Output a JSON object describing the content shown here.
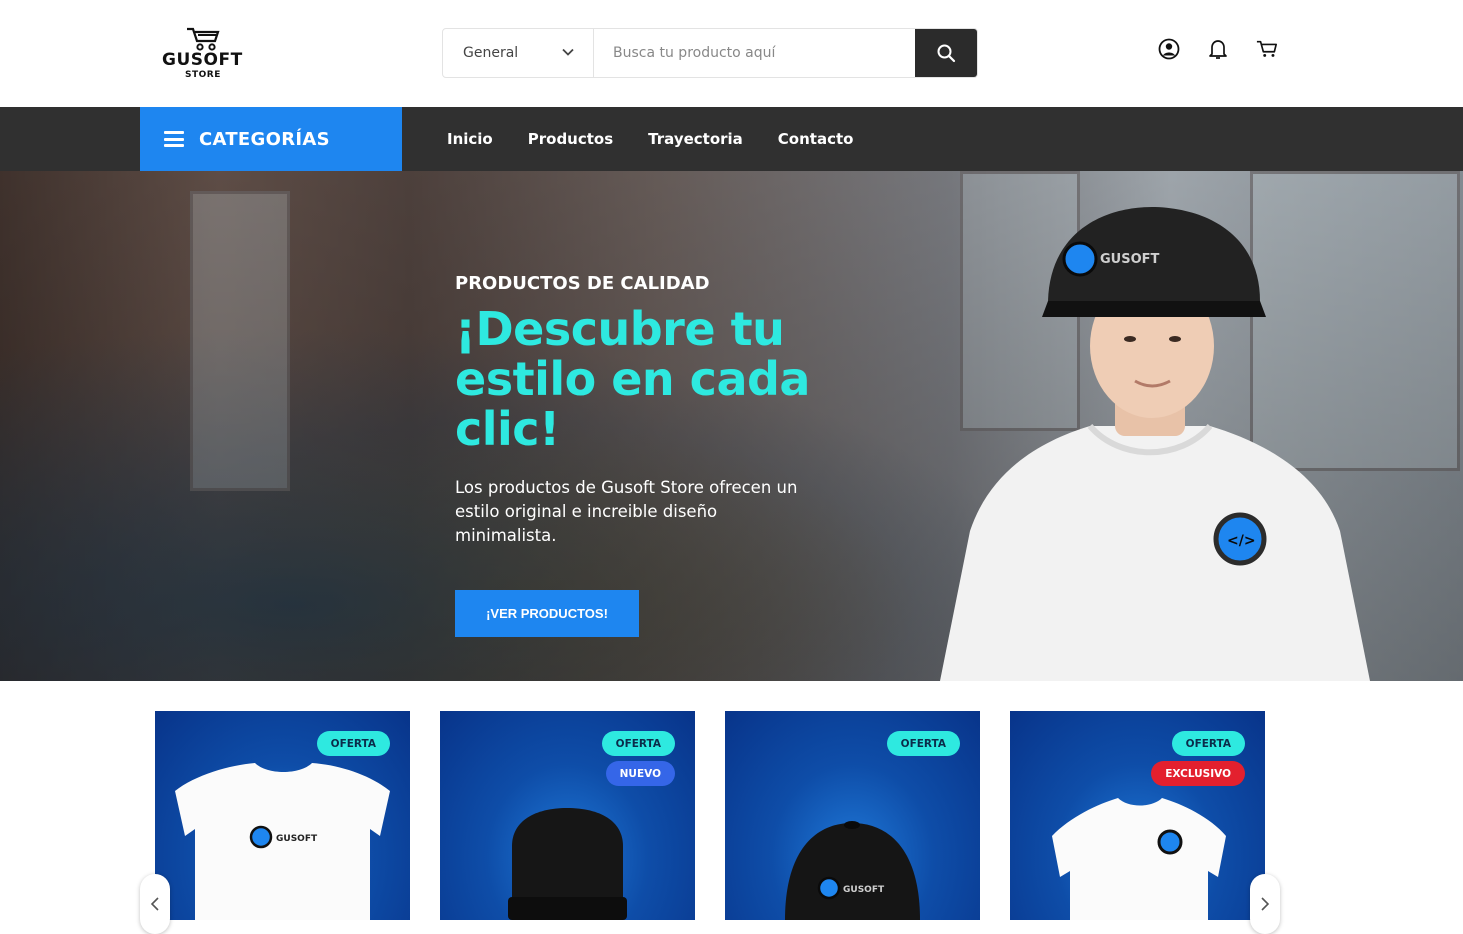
{
  "header": {
    "logo_brand": "GUSOFT",
    "logo_sub": "STORE",
    "search": {
      "category_selected": "General",
      "placeholder": "Busca tu producto aquí"
    },
    "icons": [
      "user-icon",
      "bell-icon",
      "cart-icon"
    ]
  },
  "nav": {
    "categories_label": "CATEGORÍAS",
    "links": [
      "Inicio",
      "Productos",
      "Trayectoria",
      "Contacto"
    ]
  },
  "hero": {
    "kicker": "PRODUCTOS DE CALIDAD",
    "title": "¡Descubre tu estilo en cada clic!",
    "description": "Los productos de Gusoft Store ofrecen un estilo original e increible diseño minimalista.",
    "cta": "¡VER PRODUCTOS!",
    "cap_text": "GUSOFT"
  },
  "products": [
    {
      "badges": [
        "OFERTA"
      ],
      "print": "GUSOFT"
    },
    {
      "badges": [
        "OFERTA",
        "NUEVO"
      ]
    },
    {
      "badges": [
        "OFERTA"
      ],
      "print": "GUSOFT"
    },
    {
      "badges": [
        "OFERTA",
        "EXCLUSIVO"
      ]
    }
  ],
  "colors": {
    "accent_blue": "#1e86f0",
    "accent_cyan": "#2ee9e0",
    "nav_bg": "#303030",
    "badge_nuevo": "#3566e8",
    "badge_exclusivo": "#e3202e"
  }
}
